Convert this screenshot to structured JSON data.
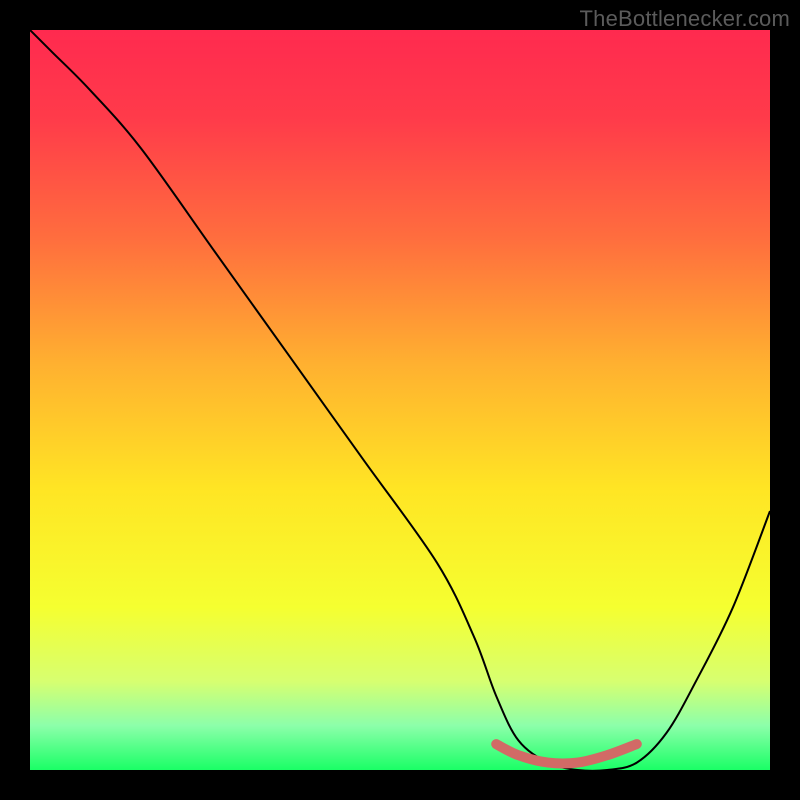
{
  "watermark": "TheBottlenecker.com",
  "chart_data": {
    "type": "line",
    "title": "",
    "xlabel": "",
    "ylabel": "",
    "xlim": [
      0,
      100
    ],
    "ylim": [
      0,
      100
    ],
    "background_gradient": {
      "stops": [
        {
          "pos": 0.0,
          "color": "#ff2a4f"
        },
        {
          "pos": 0.12,
          "color": "#ff3b4a"
        },
        {
          "pos": 0.28,
          "color": "#ff6d3e"
        },
        {
          "pos": 0.45,
          "color": "#ffb030"
        },
        {
          "pos": 0.62,
          "color": "#ffe524"
        },
        {
          "pos": 0.78,
          "color": "#f5ff30"
        },
        {
          "pos": 0.88,
          "color": "#d7ff70"
        },
        {
          "pos": 0.94,
          "color": "#8cffaa"
        },
        {
          "pos": 1.0,
          "color": "#1aff66"
        }
      ]
    },
    "series": [
      {
        "name": "bottleneck-curve",
        "x": [
          0,
          3,
          8,
          15,
          25,
          35,
          45,
          55,
          60,
          63,
          66,
          70,
          74,
          78,
          82,
          86,
          90,
          95,
          100
        ],
        "y": [
          100,
          97,
          92,
          84,
          70,
          56,
          42,
          28,
          18,
          10,
          4,
          1,
          0,
          0,
          1,
          5,
          12,
          22,
          35
        ]
      },
      {
        "name": "optimal-range",
        "x": [
          63,
          66,
          70,
          74,
          78,
          82
        ],
        "y": [
          3.5,
          2,
          1,
          1,
          2,
          3.5
        ],
        "color": "#d26a66",
        "stroke_width": 10
      }
    ]
  }
}
